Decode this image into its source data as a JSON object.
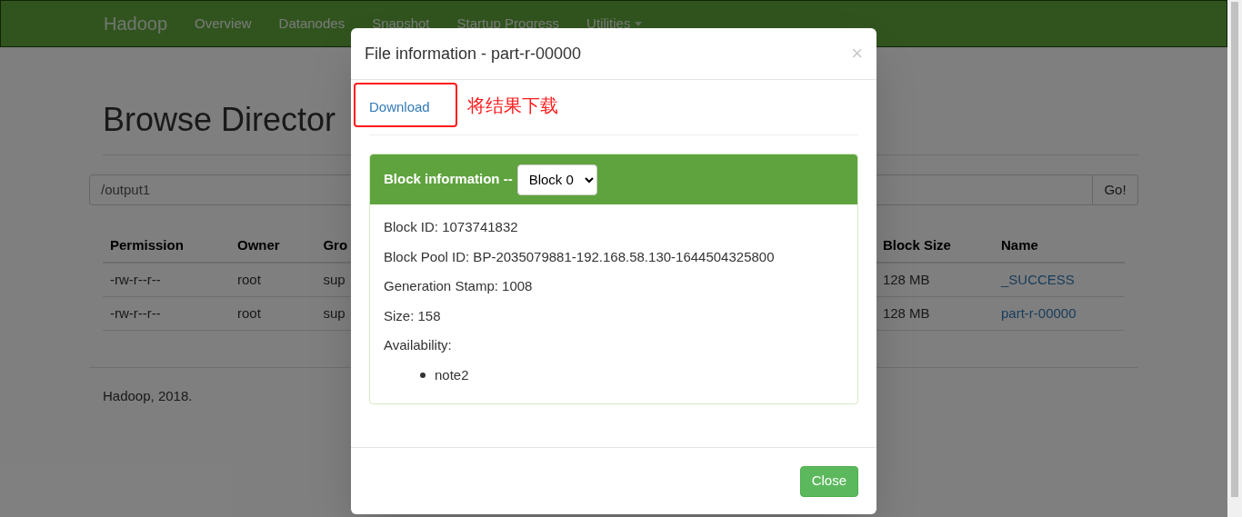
{
  "navbar": {
    "brand": "Hadoop",
    "items": [
      {
        "label": "Overview"
      },
      {
        "label": "Datanodes"
      },
      {
        "label": "Snapshot"
      },
      {
        "label": "Startup Progress"
      },
      {
        "label": "Utilities",
        "dropdown": true
      }
    ]
  },
  "page": {
    "title": "Browse Director",
    "path": "/output1",
    "go_button": "Go!",
    "table": {
      "columns": [
        "Permission",
        "Owner",
        "Gro",
        "Block Size",
        "Name"
      ],
      "rows": [
        [
          "-rw-r--r--",
          "root",
          "sup",
          "128 MB",
          "_SUCCESS"
        ],
        [
          "-rw-r--r--",
          "root",
          "sup",
          "128 MB",
          "part-r-00000"
        ]
      ]
    },
    "footer": "Hadoop, 2018."
  },
  "modal": {
    "title": "File information - part-r-00000",
    "close_icon": "×",
    "download_link": "Download",
    "annotation": "将结果下载",
    "panel": {
      "heading": "Block information --",
      "select": "Block 0",
      "fields": [
        "Block ID: 1073741832",
        "Block Pool ID: BP-2035079881-192.168.58.130-1644504325800",
        "Generation Stamp: 1008",
        "Size: 158",
        "Availability:"
      ],
      "availability": [
        "note2"
      ]
    },
    "close_button": "Close"
  }
}
